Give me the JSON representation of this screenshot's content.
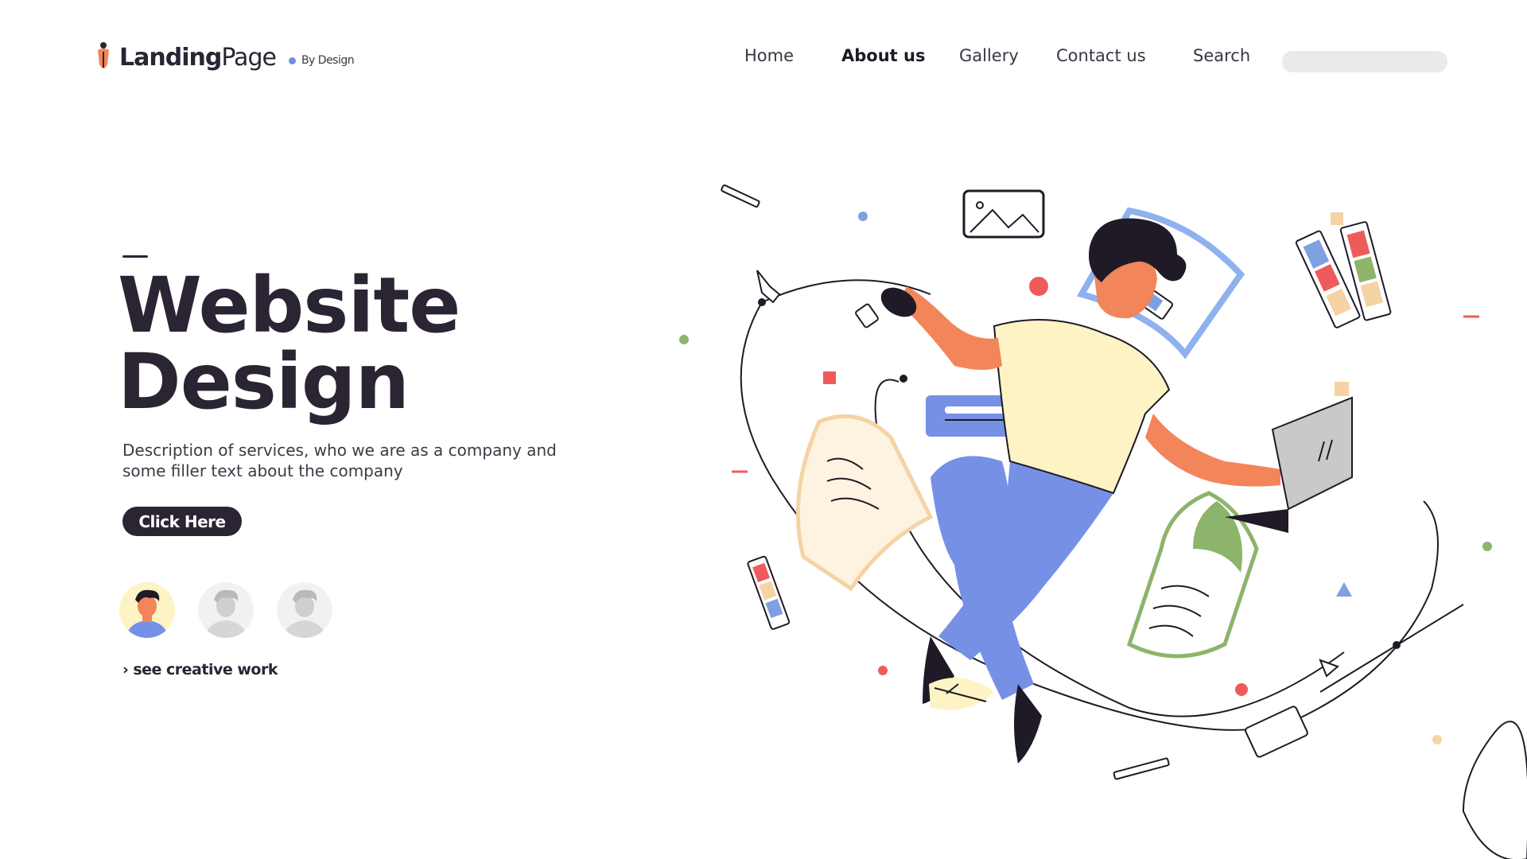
{
  "brand": {
    "name_bold": "Landing",
    "name_light": "Page",
    "tagline": "By Design",
    "icon": "pen-nib-icon",
    "accent": "#6f8fe0"
  },
  "nav": {
    "items": [
      {
        "label": "Home"
      },
      {
        "label": "About us",
        "active": true
      },
      {
        "label": "Gallery"
      },
      {
        "label": "Contact us"
      },
      {
        "label": "Search"
      }
    ],
    "search_placeholder": ""
  },
  "hero": {
    "title_line1": "Website",
    "title_line2": "Design",
    "description": "Description of services, who we are as a company and some filler text about the company",
    "cta_label": "Click Here",
    "see_more_label": "see creative work",
    "see_more_icon": "chevron-right-icon"
  },
  "avatars": [
    {
      "icon": "person-avatar-icon",
      "state": "colored"
    },
    {
      "icon": "person-avatar-icon",
      "state": "grayscale"
    },
    {
      "icon": "person-avatar-icon",
      "state": "grayscale"
    }
  ],
  "illustration": {
    "icon": "designer-floating-illustration",
    "colors": {
      "skin": "#f2855a",
      "shirt": "#fdf3c4",
      "pants": "#7690e6",
      "hair": "#1f1a26",
      "accent_red": "#ef5b5b",
      "accent_green": "#8db46b",
      "accent_peach": "#f5d3a4"
    }
  },
  "colors": {
    "text_dark": "#2a2433",
    "button_bg": "#2a2433",
    "search_bg": "#eaeaea"
  }
}
